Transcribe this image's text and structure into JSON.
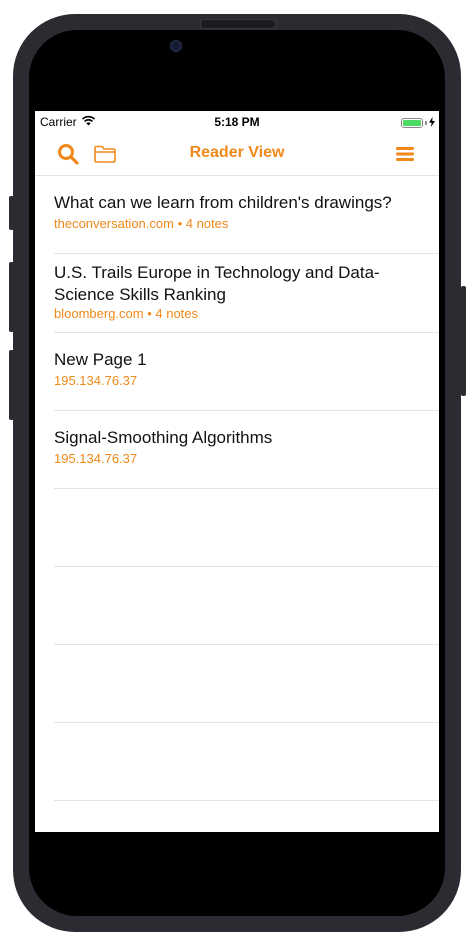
{
  "status_bar": {
    "carrier": "Carrier",
    "time": "5:18 PM",
    "battery_color": "#4cd964"
  },
  "nav": {
    "title": "Reader View",
    "left_icons": [
      "search-icon",
      "folder-icon"
    ],
    "right_icon": "menu-icon",
    "accent_color": "#f0891a"
  },
  "articles": [
    {
      "title": "What can we learn from children's drawings?",
      "subtitle": "theconversation.com • 4 notes"
    },
    {
      "title": "U.S. Trails Europe in Technology and Data-Science Skills Ranking",
      "subtitle": "bloomberg.com • 4 notes"
    },
    {
      "title": "New Page 1",
      "subtitle": "195.134.76.37"
    },
    {
      "title": "Signal-Smoothing Algorithms",
      "subtitle": "195.134.76.37"
    }
  ]
}
